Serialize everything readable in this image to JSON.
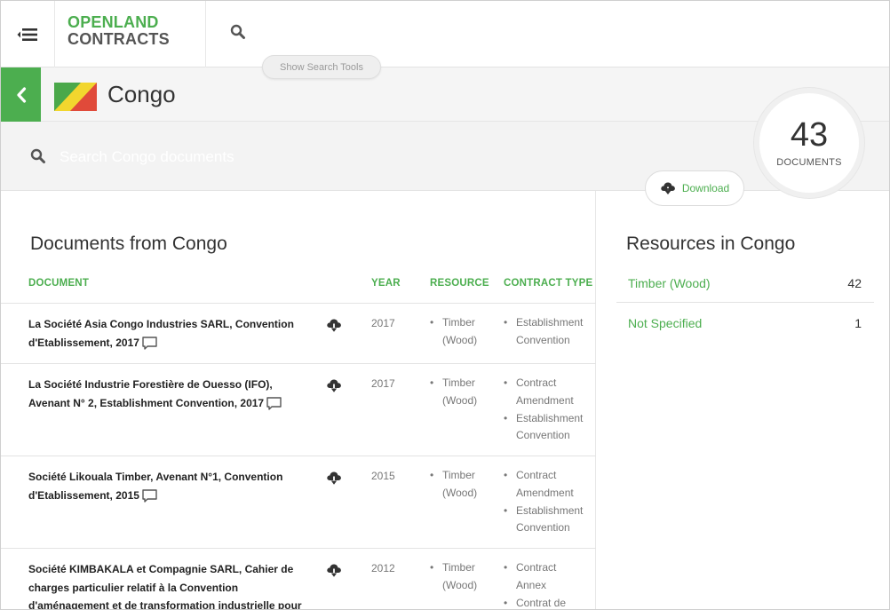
{
  "header": {
    "logo_line1": "OPENLAND",
    "logo_line2": "CONTRACTS",
    "show_search_tools": "Show Search Tools"
  },
  "country": {
    "name": "Congo"
  },
  "search": {
    "placeholder": "Search Congo documents"
  },
  "summary": {
    "count": "43",
    "label": "DOCUMENTS",
    "download_label": "Download"
  },
  "documents": {
    "title": "Documents from Congo",
    "columns": {
      "document": "DOCUMENT",
      "year": "YEAR",
      "resource": "RESOURCE",
      "contract_type": "CONTRACT TYPE"
    },
    "rows": [
      {
        "title": "La Société Asia Congo Industries SARL, Convention d'Etablissement, 2017",
        "year": "2017",
        "resources": [
          "Timber",
          "(Wood)"
        ],
        "contract_types": [
          "Establishment",
          "Convention"
        ]
      },
      {
        "title": "La Société Industrie Forestière de Ouesso (IFO), Avenant N° 2, Establishment Convention, 2017",
        "year": "2017",
        "resources": [
          "Timber",
          "(Wood)"
        ],
        "contract_types": [
          "Contract",
          "Amendment",
          "Establishment",
          "Convention"
        ]
      },
      {
        "title": "Société Likouala Timber, Avenant N°1, Convention d'Etablissement, 2015",
        "year": "2015",
        "resources": [
          "Timber",
          "(Wood)"
        ],
        "contract_types": [
          "Contract",
          "Amendment",
          "Establishment",
          "Convention"
        ]
      },
      {
        "title": "Société KIMBAKALA et Compagnie SARL, Cahier de charges particulier relatif à la Convention d'aménagement et de transformation industrielle pour",
        "year": "2012",
        "resources": [
          "Timber",
          "(Wood)"
        ],
        "contract_types": [
          "Contract",
          "Annex",
          "Contrat de"
        ]
      }
    ]
  },
  "resources": {
    "title": "Resources in Congo",
    "items": [
      {
        "name": "Timber (Wood)",
        "count": "42"
      },
      {
        "name": "Not Specified",
        "count": "1"
      }
    ]
  },
  "colors": {
    "accent": "#4cae4f",
    "flag_green": "#4aa84a",
    "flag_yellow": "#f2d62e",
    "flag_red": "#e04a3a"
  },
  "icons": [
    "menu-icon",
    "search-icon",
    "back-arrow-icon",
    "congo-flag",
    "cloud-download-icon",
    "comment-icon"
  ]
}
